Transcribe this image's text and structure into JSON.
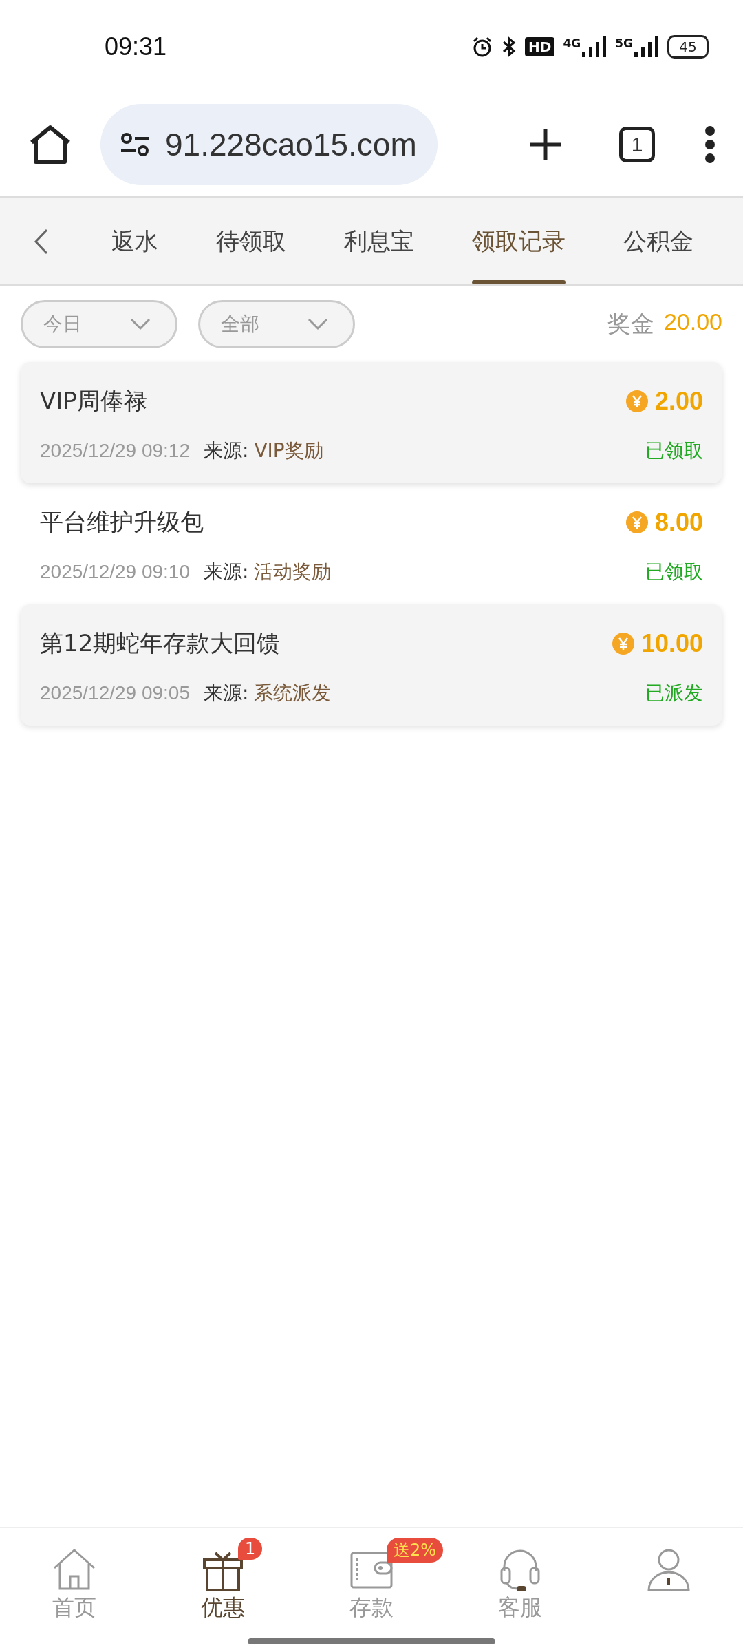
{
  "status_bar": {
    "time": "09:31",
    "hd": "HD",
    "network_1": "4G",
    "network_2": "5G",
    "battery": "45"
  },
  "browser": {
    "url": "91.228cao15.com",
    "tab_count": "1"
  },
  "tabs": [
    {
      "label": "返水",
      "selected": false
    },
    {
      "label": "待领取",
      "selected": false
    },
    {
      "label": "利息宝",
      "selected": false
    },
    {
      "label": "领取记录",
      "selected": true
    },
    {
      "label": "公积金",
      "selected": false
    }
  ],
  "filters": [
    {
      "value": "今日"
    },
    {
      "value": "全部"
    }
  ],
  "bonus": {
    "label": "奖金",
    "amount": "20.00"
  },
  "records": [
    {
      "title": "VIP周俸禄",
      "amount": "2.00",
      "time": "2025/12/29 09:12",
      "source_label": "来源:",
      "source": "VIP奖励",
      "status": "已领取",
      "shaded": true
    },
    {
      "title": "平台维护升级包",
      "amount": "8.00",
      "time": "2025/12/29 09:10",
      "source_label": "来源:",
      "source": "活动奖励",
      "status": "已领取",
      "shaded": false
    },
    {
      "title": "第12期蛇年存款大回馈",
      "amount": "10.00",
      "time": "2025/12/29 09:05",
      "source_label": "来源:",
      "source": "系统派发",
      "status": "已派发",
      "shaded": true
    }
  ],
  "bottom_nav": [
    {
      "kind": "home",
      "label": "首页",
      "selected": false
    },
    {
      "kind": "gift",
      "label": "优惠",
      "selected": true,
      "badge": "1"
    },
    {
      "kind": "wallet",
      "label": "存款",
      "selected": false,
      "badge": "送2%"
    },
    {
      "kind": "headset",
      "label": "客服",
      "selected": false
    },
    {
      "kind": "person",
      "selected": false
    }
  ]
}
